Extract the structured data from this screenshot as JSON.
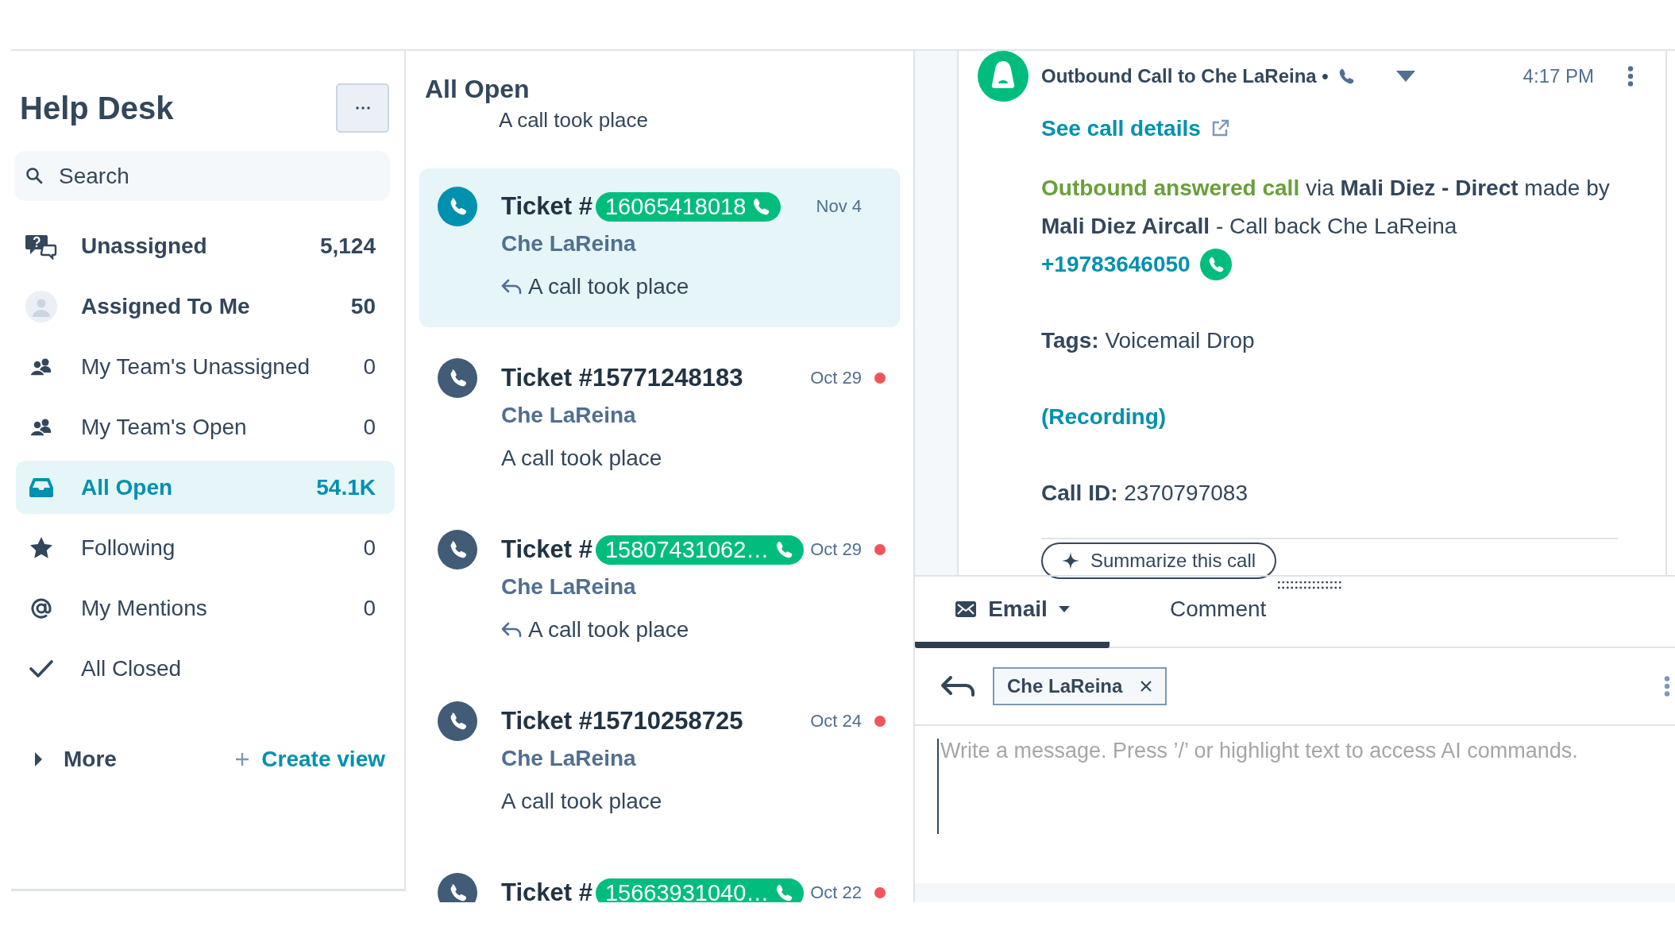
{
  "sidebar": {
    "title": "Help Desk",
    "search": {
      "placeholder": "Search"
    },
    "views": [
      {
        "label": "Unassigned",
        "count": "5,124",
        "kind": "unassigned",
        "bold": true,
        "selected": false
      },
      {
        "label": "Assigned To Me",
        "count": "50",
        "kind": "me",
        "bold": true,
        "selected": false
      },
      {
        "label": "My Team's Unassigned",
        "count": "0",
        "kind": "team",
        "bold": false,
        "selected": false
      },
      {
        "label": "My Team's Open",
        "count": "0",
        "kind": "team",
        "bold": false,
        "selected": false
      },
      {
        "label": "All Open",
        "count": "54.1K",
        "kind": "inbox",
        "bold": true,
        "selected": true
      },
      {
        "label": "Following",
        "count": "0",
        "kind": "star",
        "bold": false,
        "selected": false
      },
      {
        "label": "My Mentions",
        "count": "0",
        "kind": "mention",
        "bold": false,
        "selected": false
      },
      {
        "label": "All Closed",
        "kind": "check",
        "bold": false,
        "selected": false
      }
    ],
    "more": "More",
    "create_view": "Create view"
  },
  "list": {
    "title": "All Open",
    "partial_subject": "A call took place",
    "tickets": [
      {
        "title": "Ticket #",
        "number": "16065418018",
        "kind": "chip",
        "date": "Nov 4",
        "unread": false,
        "contact": "Che LaReina",
        "subject": "A call took place",
        "replied": true,
        "selected": true
      },
      {
        "title": "Ticket #",
        "number": "15771248183",
        "kind": "plain",
        "date": "Oct 29",
        "unread": true,
        "contact": "Che LaReina",
        "subject": "A call took place",
        "replied": false,
        "selected": false
      },
      {
        "title": "Ticket #",
        "number": "15807431062…",
        "kind": "chip",
        "date": "Oct 29",
        "unread": true,
        "contact": "Che LaReina",
        "subject": "A call took place",
        "replied": true,
        "selected": false
      },
      {
        "title": "Ticket #",
        "number": "15710258725",
        "kind": "plain",
        "date": "Oct 24",
        "unread": true,
        "contact": "Che LaReina",
        "subject": "A call took place",
        "replied": false,
        "selected": false
      },
      {
        "title": "Ticket #",
        "number": "15663931040…",
        "kind": "chip",
        "date": "Oct 22",
        "unread": true,
        "selected": false
      }
    ]
  },
  "detail": {
    "header": "Outbound Call to Che LaReina •",
    "time": "4:17 PM",
    "details_link": "See call details",
    "status": "Outbound answered call",
    "description": " via **Mali Diez - Direct** made by **Mali Diez Aircall** - Call back Che LaReina",
    "phone": "+19783646050",
    "tags": "**Tags:** Voicemail Drop",
    "recording_link": "(Recording)",
    "call_id": "**Call ID:** 2370797083",
    "summarize_button": "Summarize this call"
  },
  "composer": {
    "tabs": [
      {
        "label": "Email",
        "kind": "email",
        "selected": true
      },
      {
        "label": "Comment",
        "kind": "comment",
        "selected": false
      }
    ],
    "recipient": "Che LaReina",
    "placeholder": "Write a message. Press ’/’ or highlight text to access AI commands."
  }
}
